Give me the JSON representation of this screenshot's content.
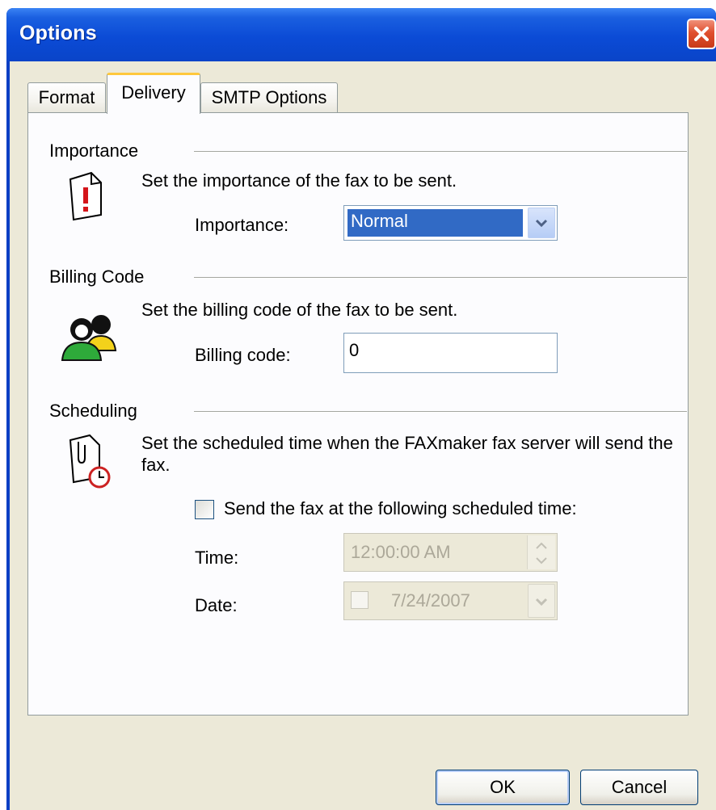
{
  "window": {
    "title": "Options"
  },
  "tabs": [
    {
      "label": "Format"
    },
    {
      "label": "Delivery"
    },
    {
      "label": "SMTP Options"
    }
  ],
  "importance": {
    "section": "Importance",
    "description": "Set the importance of the fax to be sent.",
    "field_label": "Importance:",
    "value": "Normal"
  },
  "billing": {
    "section": "Billing Code",
    "description": "Set the billing code of the fax to be sent.",
    "field_label": "Billing code:",
    "value": "0"
  },
  "scheduling": {
    "section": "Scheduling",
    "description": "Set the scheduled time when the FAXmaker fax server will send the fax.",
    "checkbox_label": "Send the fax at the following scheduled time:",
    "checkbox_checked": false,
    "time_label": "Time:",
    "time_value": "12:00:00 AM",
    "date_label": "Date:",
    "date_value": "7/24/2007"
  },
  "buttons": {
    "ok": "OK",
    "cancel": "Cancel"
  },
  "colors": {
    "titlebar": "#0a44c8",
    "close": "#e0502e",
    "selection": "#316ac5",
    "tab_highlight": "#ffc83c"
  }
}
